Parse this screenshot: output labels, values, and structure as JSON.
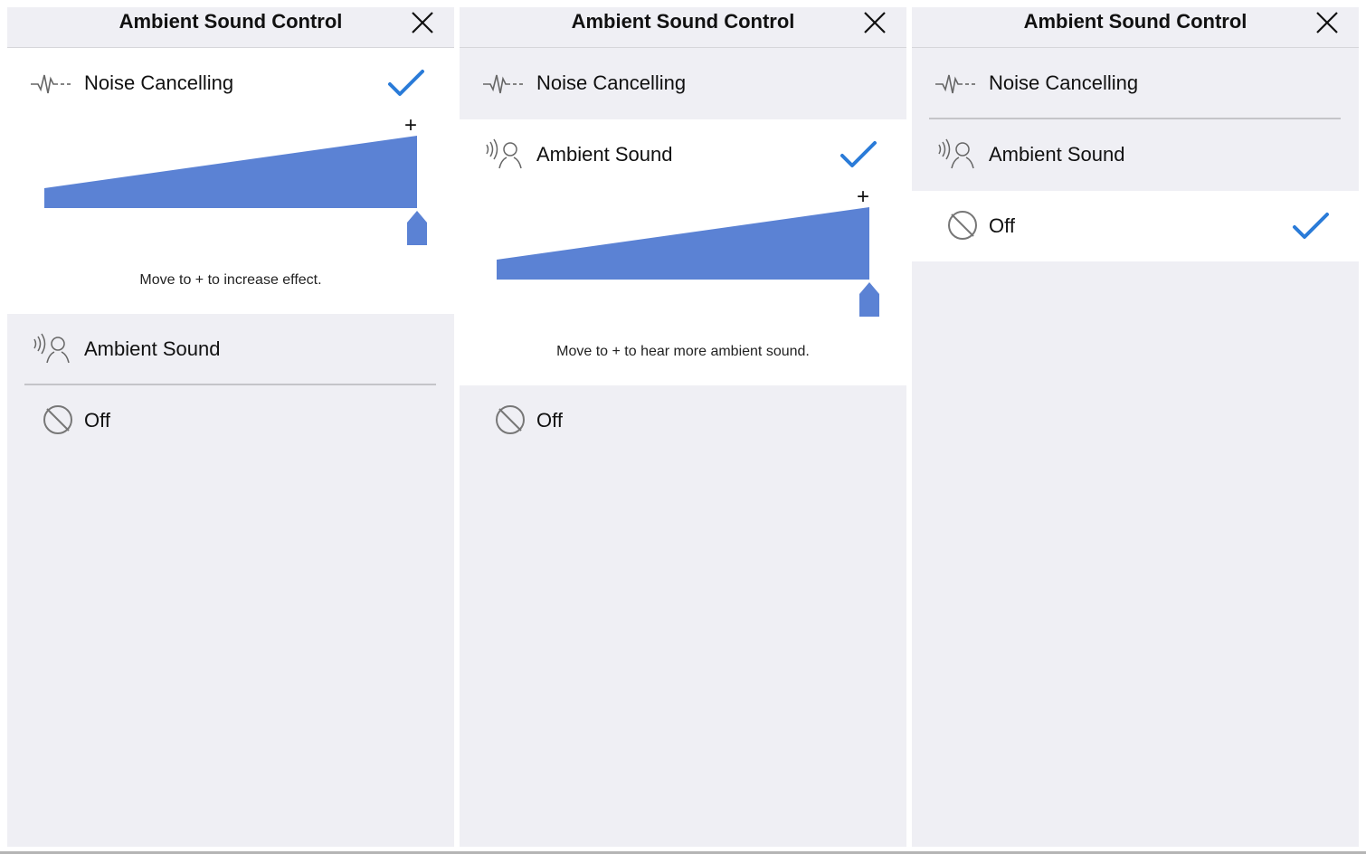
{
  "colors": {
    "accent": "#2a7bd8",
    "slider_fill": "#5b82d4",
    "background": "#efeff4",
    "selected_row": "#ffffff"
  },
  "panels": [
    {
      "header": {
        "title": "Ambient Sound Control",
        "close_icon": "close-icon"
      },
      "selected": "noise_cancelling",
      "options": [
        {
          "id": "noise_cancelling",
          "label": "Noise Cancelling",
          "icon": "noise-cancelling-waveform-icon",
          "checked": true,
          "slider": {
            "plus_label": "+",
            "level": 1.0,
            "hint": "Move to + to increase effect."
          }
        },
        {
          "id": "ambient_sound",
          "label": "Ambient Sound",
          "icon": "ambient-sound-person-icon",
          "checked": false
        },
        {
          "id": "off",
          "label": "Off",
          "icon": "off-prohibited-icon",
          "checked": false
        }
      ]
    },
    {
      "header": {
        "title": "Ambient Sound Control",
        "close_icon": "close-icon"
      },
      "selected": "ambient_sound",
      "options": [
        {
          "id": "noise_cancelling",
          "label": "Noise Cancelling",
          "icon": "noise-cancelling-waveform-icon",
          "checked": false
        },
        {
          "id": "ambient_sound",
          "label": "Ambient Sound",
          "icon": "ambient-sound-person-icon",
          "checked": true,
          "slider": {
            "plus_label": "+",
            "level": 1.0,
            "hint": "Move to + to hear more ambient sound."
          }
        },
        {
          "id": "off",
          "label": "Off",
          "icon": "off-prohibited-icon",
          "checked": false
        }
      ]
    },
    {
      "header": {
        "title": "Ambient Sound Control",
        "close_icon": "close-icon"
      },
      "selected": "off",
      "options": [
        {
          "id": "noise_cancelling",
          "label": "Noise Cancelling",
          "icon": "noise-cancelling-waveform-icon",
          "checked": false
        },
        {
          "id": "ambient_sound",
          "label": "Ambient Sound",
          "icon": "ambient-sound-person-icon",
          "checked": false
        },
        {
          "id": "off",
          "label": "Off",
          "icon": "off-prohibited-icon",
          "checked": true
        }
      ]
    }
  ]
}
